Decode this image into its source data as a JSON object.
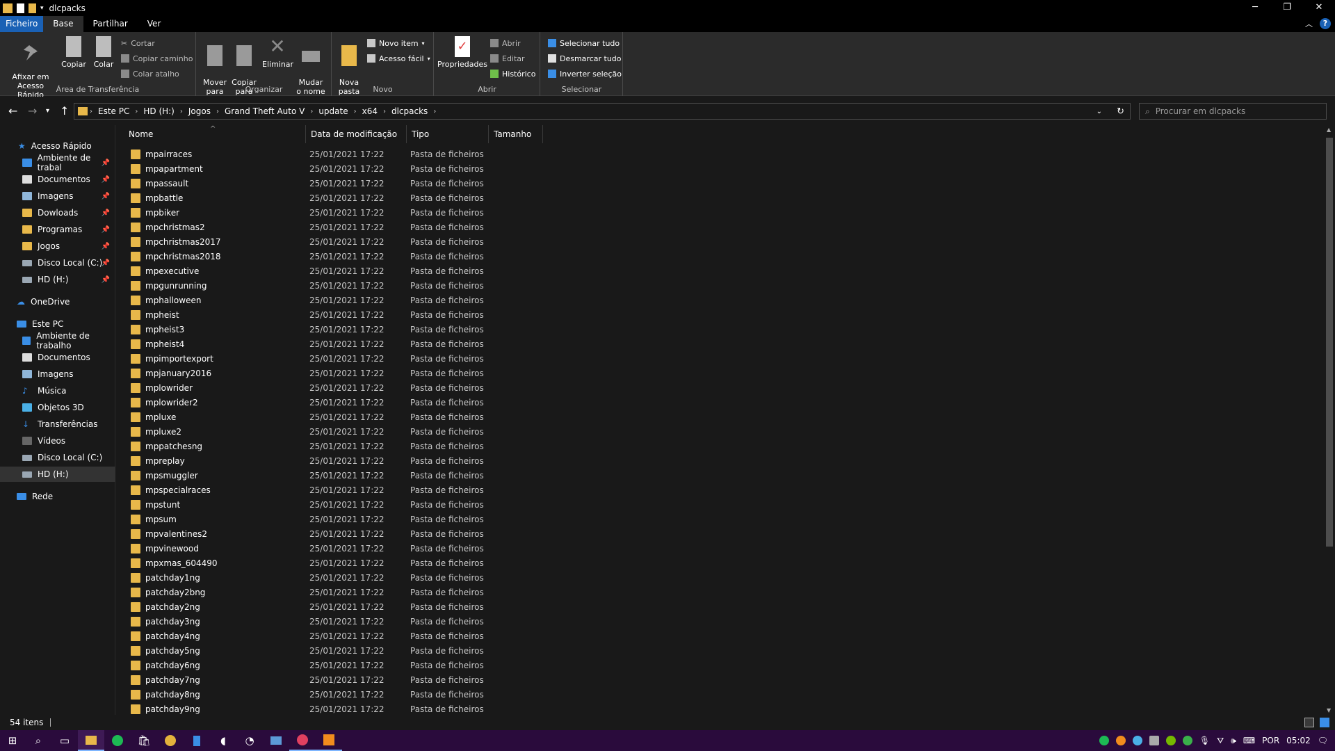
{
  "window": {
    "title": "dlcpacks",
    "controls": {
      "min": "─",
      "max": "❐",
      "close": "✕"
    }
  },
  "menu": {
    "tabs": [
      "Ficheiro",
      "Base",
      "Partilhar",
      "Ver"
    ],
    "help": "?"
  },
  "ribbon": {
    "clipboard": {
      "label": "Área de Transferência",
      "pin": "Afixar em\nAcesso Rápido",
      "copy": "Copiar",
      "paste": "Colar",
      "cut": "Cortar",
      "copy_path": "Copiar caminho",
      "paste_shortcut": "Colar atalho"
    },
    "organize": {
      "label": "Organizar",
      "move": "Mover\npara",
      "copyto": "Copiar\npara",
      "delete": "Eliminar",
      "rename": "Mudar\no nome"
    },
    "new": {
      "label": "Novo",
      "folder": "Nova\npasta",
      "item": "Novo item",
      "easy": "Acesso fácil"
    },
    "open": {
      "label": "Abrir",
      "props": "Propriedades",
      "open": "Abrir",
      "edit": "Editar",
      "history": "Histórico"
    },
    "select": {
      "label": "Selecionar",
      "all": "Selecionar tudo",
      "none": "Desmarcar tudo",
      "invert": "Inverter seleção"
    }
  },
  "address": {
    "crumbs": [
      "Este PC",
      "HD (H:)",
      "Jogos",
      "Grand Theft Auto V",
      "update",
      "x64",
      "dlcpacks"
    ],
    "search_placeholder": "Procurar em dlcpacks"
  },
  "nav": {
    "quick": "Acesso Rápido",
    "quick_items": [
      "Ambiente de trabal",
      "Documentos",
      "Imagens",
      "Dowloads",
      "Programas",
      "Jogos",
      "Disco Local (C:)",
      "HD (H:)"
    ],
    "onedrive": "OneDrive",
    "pc": "Este PC",
    "pc_items": [
      "Ambiente de trabalho",
      "Documentos",
      "Imagens",
      "Música",
      "Objetos 3D",
      "Transferências",
      "Vídeos",
      "Disco Local (C:)",
      "HD (H:)"
    ],
    "network": "Rede"
  },
  "columns": {
    "name": "Nome",
    "date": "Data de modificação",
    "type": "Tipo",
    "size": "Tamanho"
  },
  "files": [
    "mpairraces",
    "mpapartment",
    "mpassault",
    "mpbattle",
    "mpbiker",
    "mpchristmas2",
    "mpchristmas2017",
    "mpchristmas2018",
    "mpexecutive",
    "mpgunrunning",
    "mphalloween",
    "mpheist",
    "mpheist3",
    "mpheist4",
    "mpimportexport",
    "mpjanuary2016",
    "mplowrider",
    "mplowrider2",
    "mpluxe",
    "mpluxe2",
    "mppatchesng",
    "mpreplay",
    "mpsmuggler",
    "mpspecialraces",
    "mpstunt",
    "mpsum",
    "mpvalentines2",
    "mpvinewood",
    "mpxmas_604490",
    "patchday1ng",
    "patchday2bng",
    "patchday2ng",
    "patchday3ng",
    "patchday4ng",
    "patchday5ng",
    "patchday6ng",
    "patchday7ng",
    "patchday8ng",
    "patchday9ng"
  ],
  "file_date": "25/01/2021 17:22",
  "file_type": "Pasta de ficheiros",
  "status": {
    "count": "54 itens"
  },
  "taskbar": {
    "lang": "POR",
    "time": "05:02"
  }
}
